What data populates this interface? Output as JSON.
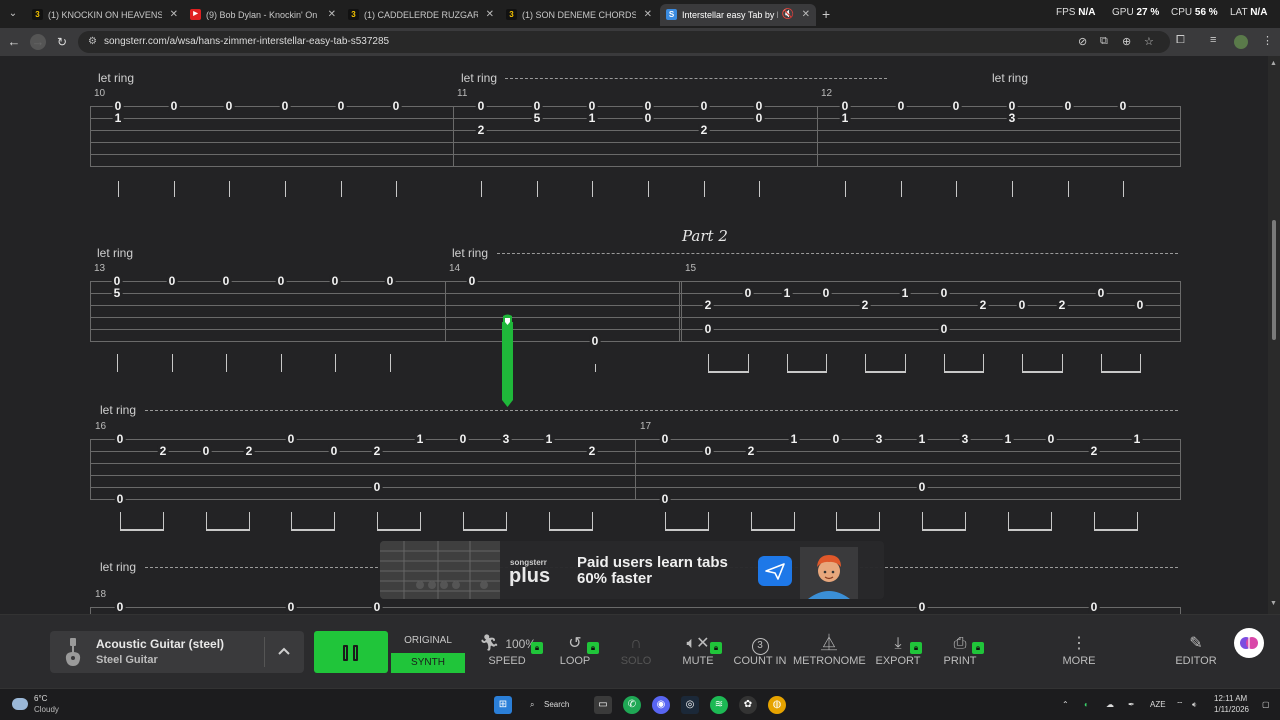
{
  "browser": {
    "tabs": [
      {
        "label": "(1) KNOCKIN ON HEAVENS DO",
        "favicon": "3"
      },
      {
        "label": "(9) Bob Dylan - Knockin' On He",
        "favicon": "▶"
      },
      {
        "label": "(1) CADDELERDE RUZGAR INTR",
        "favicon": "3"
      },
      {
        "label": "(1) SON DENEME CHORDS by M",
        "favicon": "3"
      },
      {
        "label": "Interstellar easy Tab by Han",
        "favicon": "S"
      }
    ],
    "url": "songsterr.com/a/wsa/hans-zimmer-interstellar-easy-tab-s537285",
    "perf": {
      "fps_label": "FPS",
      "fps": "N/A",
      "gpu_label": "GPU",
      "gpu": "27 %",
      "cpu_label": "CPU",
      "cpu": "56 %",
      "lat_label": "LAT",
      "lat": "N/A"
    }
  },
  "tab": {
    "let_ring": "let ring",
    "part_title": "Part 2",
    "measures": [
      "10",
      "11",
      "12",
      "13",
      "14",
      "15",
      "16",
      "17",
      "18"
    ]
  },
  "ad": {
    "brand_top": "songsterr",
    "brand": "plus",
    "text": "Paid users learn tabs 60% faster"
  },
  "player": {
    "instrument_name": "Acoustic Guitar (steel)",
    "instrument_sub": "Steel Guitar",
    "mode_original": "ORIGINAL",
    "mode_synth": "SYNTH",
    "speed_value": "100%",
    "controls": [
      {
        "name": "speed",
        "label": "SPEED",
        "icon": "runner-icon",
        "locked": true
      },
      {
        "name": "loop",
        "label": "LOOP",
        "icon": "loop-icon",
        "locked": true
      },
      {
        "name": "solo",
        "label": "SOLO",
        "icon": "headphones-icon",
        "locked": false
      },
      {
        "name": "mute",
        "label": "MUTE",
        "icon": "mute-icon",
        "locked": true
      },
      {
        "name": "count-in",
        "label": "COUNT IN",
        "icon": "count-in-icon",
        "locked": false
      },
      {
        "name": "metronome",
        "label": "METRONOME",
        "icon": "metronome-icon",
        "locked": false
      },
      {
        "name": "export",
        "label": "EXPORT",
        "icon": "download-icon",
        "locked": true
      },
      {
        "name": "print",
        "label": "PRINT",
        "icon": "printer-icon",
        "locked": true
      },
      {
        "name": "more",
        "label": "MORE",
        "icon": "more-icon",
        "locked": false
      },
      {
        "name": "editor",
        "label": "EDITOR",
        "icon": "pencil-icon",
        "locked": false
      }
    ],
    "count_in_value": "3"
  },
  "taskbar": {
    "temperature": "6°C",
    "weather": "Cloudy",
    "search": "Search",
    "lang": "AZE",
    "time": "12:11 AM",
    "date": "1/11/2026"
  },
  "colors": {
    "accent_green": "#20c53a",
    "background": "#232325",
    "plus_blue": "#1e78e8"
  }
}
